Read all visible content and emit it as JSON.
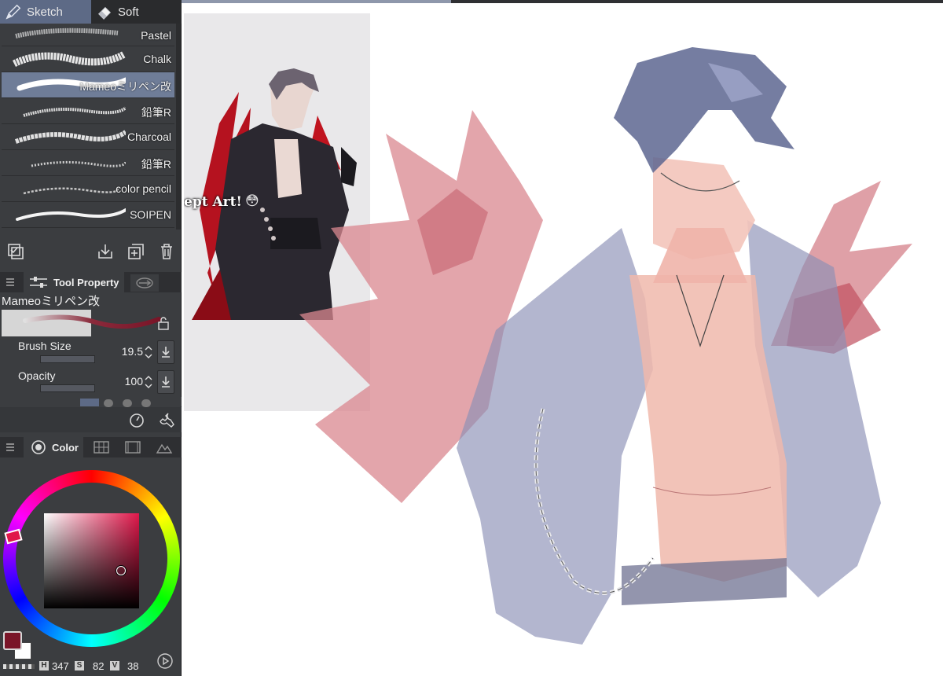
{
  "tabs": [
    {
      "label": "Sketch",
      "icon": "pencil-icon"
    },
    {
      "label": "Soft",
      "icon": "eraser-icon"
    }
  ],
  "brushes": [
    {
      "name": "Pastel"
    },
    {
      "name": "Chalk"
    },
    {
      "name": "Mameoミリペン改",
      "selected": true
    },
    {
      "name": "鉛筆R"
    },
    {
      "name": "Charcoal"
    },
    {
      "name": "鉛筆R"
    },
    {
      "name": "color pencil"
    },
    {
      "name": "SOIPEN"
    }
  ],
  "tool_property": {
    "tab_label": "Tool Property",
    "brush_name": "Mameoミリペン改",
    "brush_size": {
      "label": "Brush Size",
      "value": "19.5"
    },
    "opacity": {
      "label": "Opacity",
      "value": "100"
    }
  },
  "color_panel": {
    "tab_label": "Color",
    "h_label": "H",
    "h_value": "347",
    "s_label": "S",
    "s_value": "82",
    "v_label": "V",
    "v_value": "38",
    "main_color": "#7a1528"
  },
  "canvas": {
    "reference_caption": "ept Art!",
    "reference_emoji": "😳"
  }
}
